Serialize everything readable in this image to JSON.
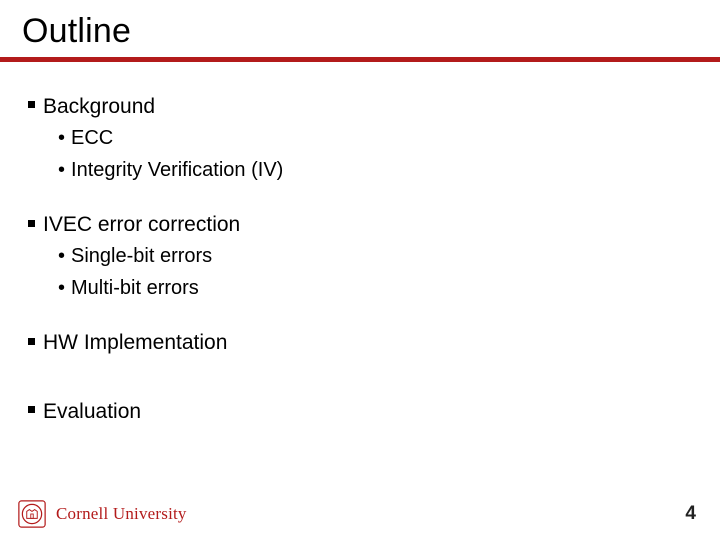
{
  "title": "Outline",
  "sections": [
    {
      "label": "Background",
      "items": [
        "ECC",
        "Integrity Verification (IV)"
      ]
    },
    {
      "label": "IVEC error correction",
      "items": [
        "Single-bit errors",
        "Multi-bit errors"
      ]
    },
    {
      "label": "HW Implementation",
      "items": []
    },
    {
      "label": "Evaluation",
      "items": []
    }
  ],
  "footer": {
    "institution": "Cornell University",
    "page_number": "4"
  },
  "colors": {
    "accent": "#b31b1b"
  }
}
